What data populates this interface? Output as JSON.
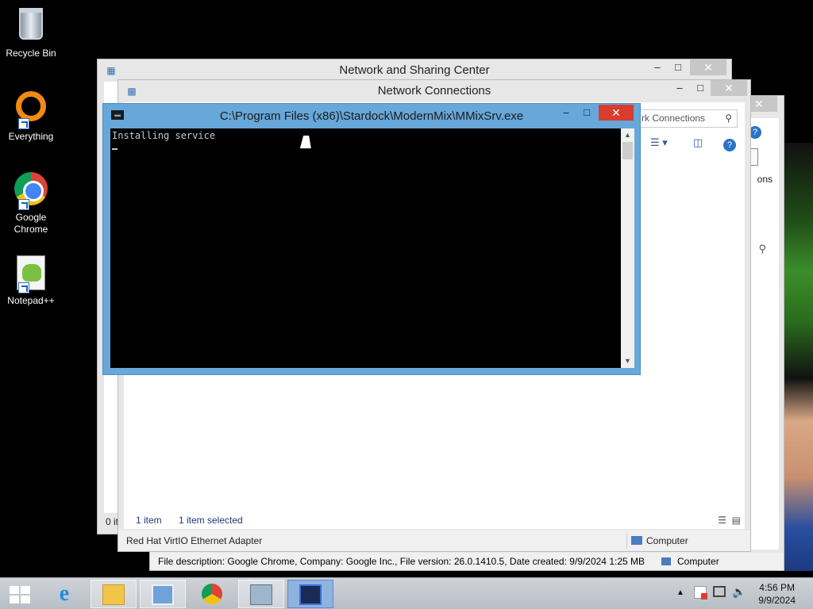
{
  "desktop": {
    "icons": [
      {
        "label": "Recycle Bin",
        "icon": "recycle-bin-icon"
      },
      {
        "label": "Everything",
        "icon": "everything-search-icon"
      },
      {
        "label": "Google Chrome",
        "icon": "chrome-icon"
      },
      {
        "label": "Notepad++",
        "icon": "notepad-plus-plus-icon"
      }
    ]
  },
  "windows": {
    "network_sharing_center": {
      "title": "Network and Sharing Center",
      "status_fragment": "0 it"
    },
    "explorer_right": {
      "side_text": "ons",
      "status_description": "File description: Google Chrome, Company: Google Inc., File version: 26.0.1410.5, Date created: 9/9/2024 1:25 MB",
      "status_location": "Computer"
    },
    "network_connections": {
      "title": "Network Connections",
      "search_placeholder": "rk Connections",
      "item_count": "1 item",
      "selected_count": "1 item selected",
      "status_item": "Red Hat VirtIO Ethernet Adapter",
      "status_location": "Computer"
    },
    "console": {
      "title": "C:\\Program Files (x86)\\Stardock\\ModernMix\\MMixSrv.exe",
      "output": "Installing service"
    }
  },
  "window_controls": {
    "minimize": "–",
    "maximize": "□",
    "close": "✕"
  },
  "taskbar": {
    "items": [
      {
        "name": "internet-explorer",
        "icon": "ie-icon"
      },
      {
        "name": "file-explorer",
        "icon": "folder-icon"
      },
      {
        "name": "control-panel",
        "icon": "control-panel-icon"
      },
      {
        "name": "google-chrome",
        "icon": "chrome-icon"
      },
      {
        "name": "setup",
        "icon": "installer-icon"
      },
      {
        "name": "console",
        "icon": "console-icon"
      }
    ],
    "clock_time": "4:56 PM",
    "clock_date": "9/9/2024"
  },
  "colors": {
    "console_titlebar": "#67a7d9",
    "close_button_active": "#d93d30",
    "taskbar": "#c4c9cf"
  }
}
